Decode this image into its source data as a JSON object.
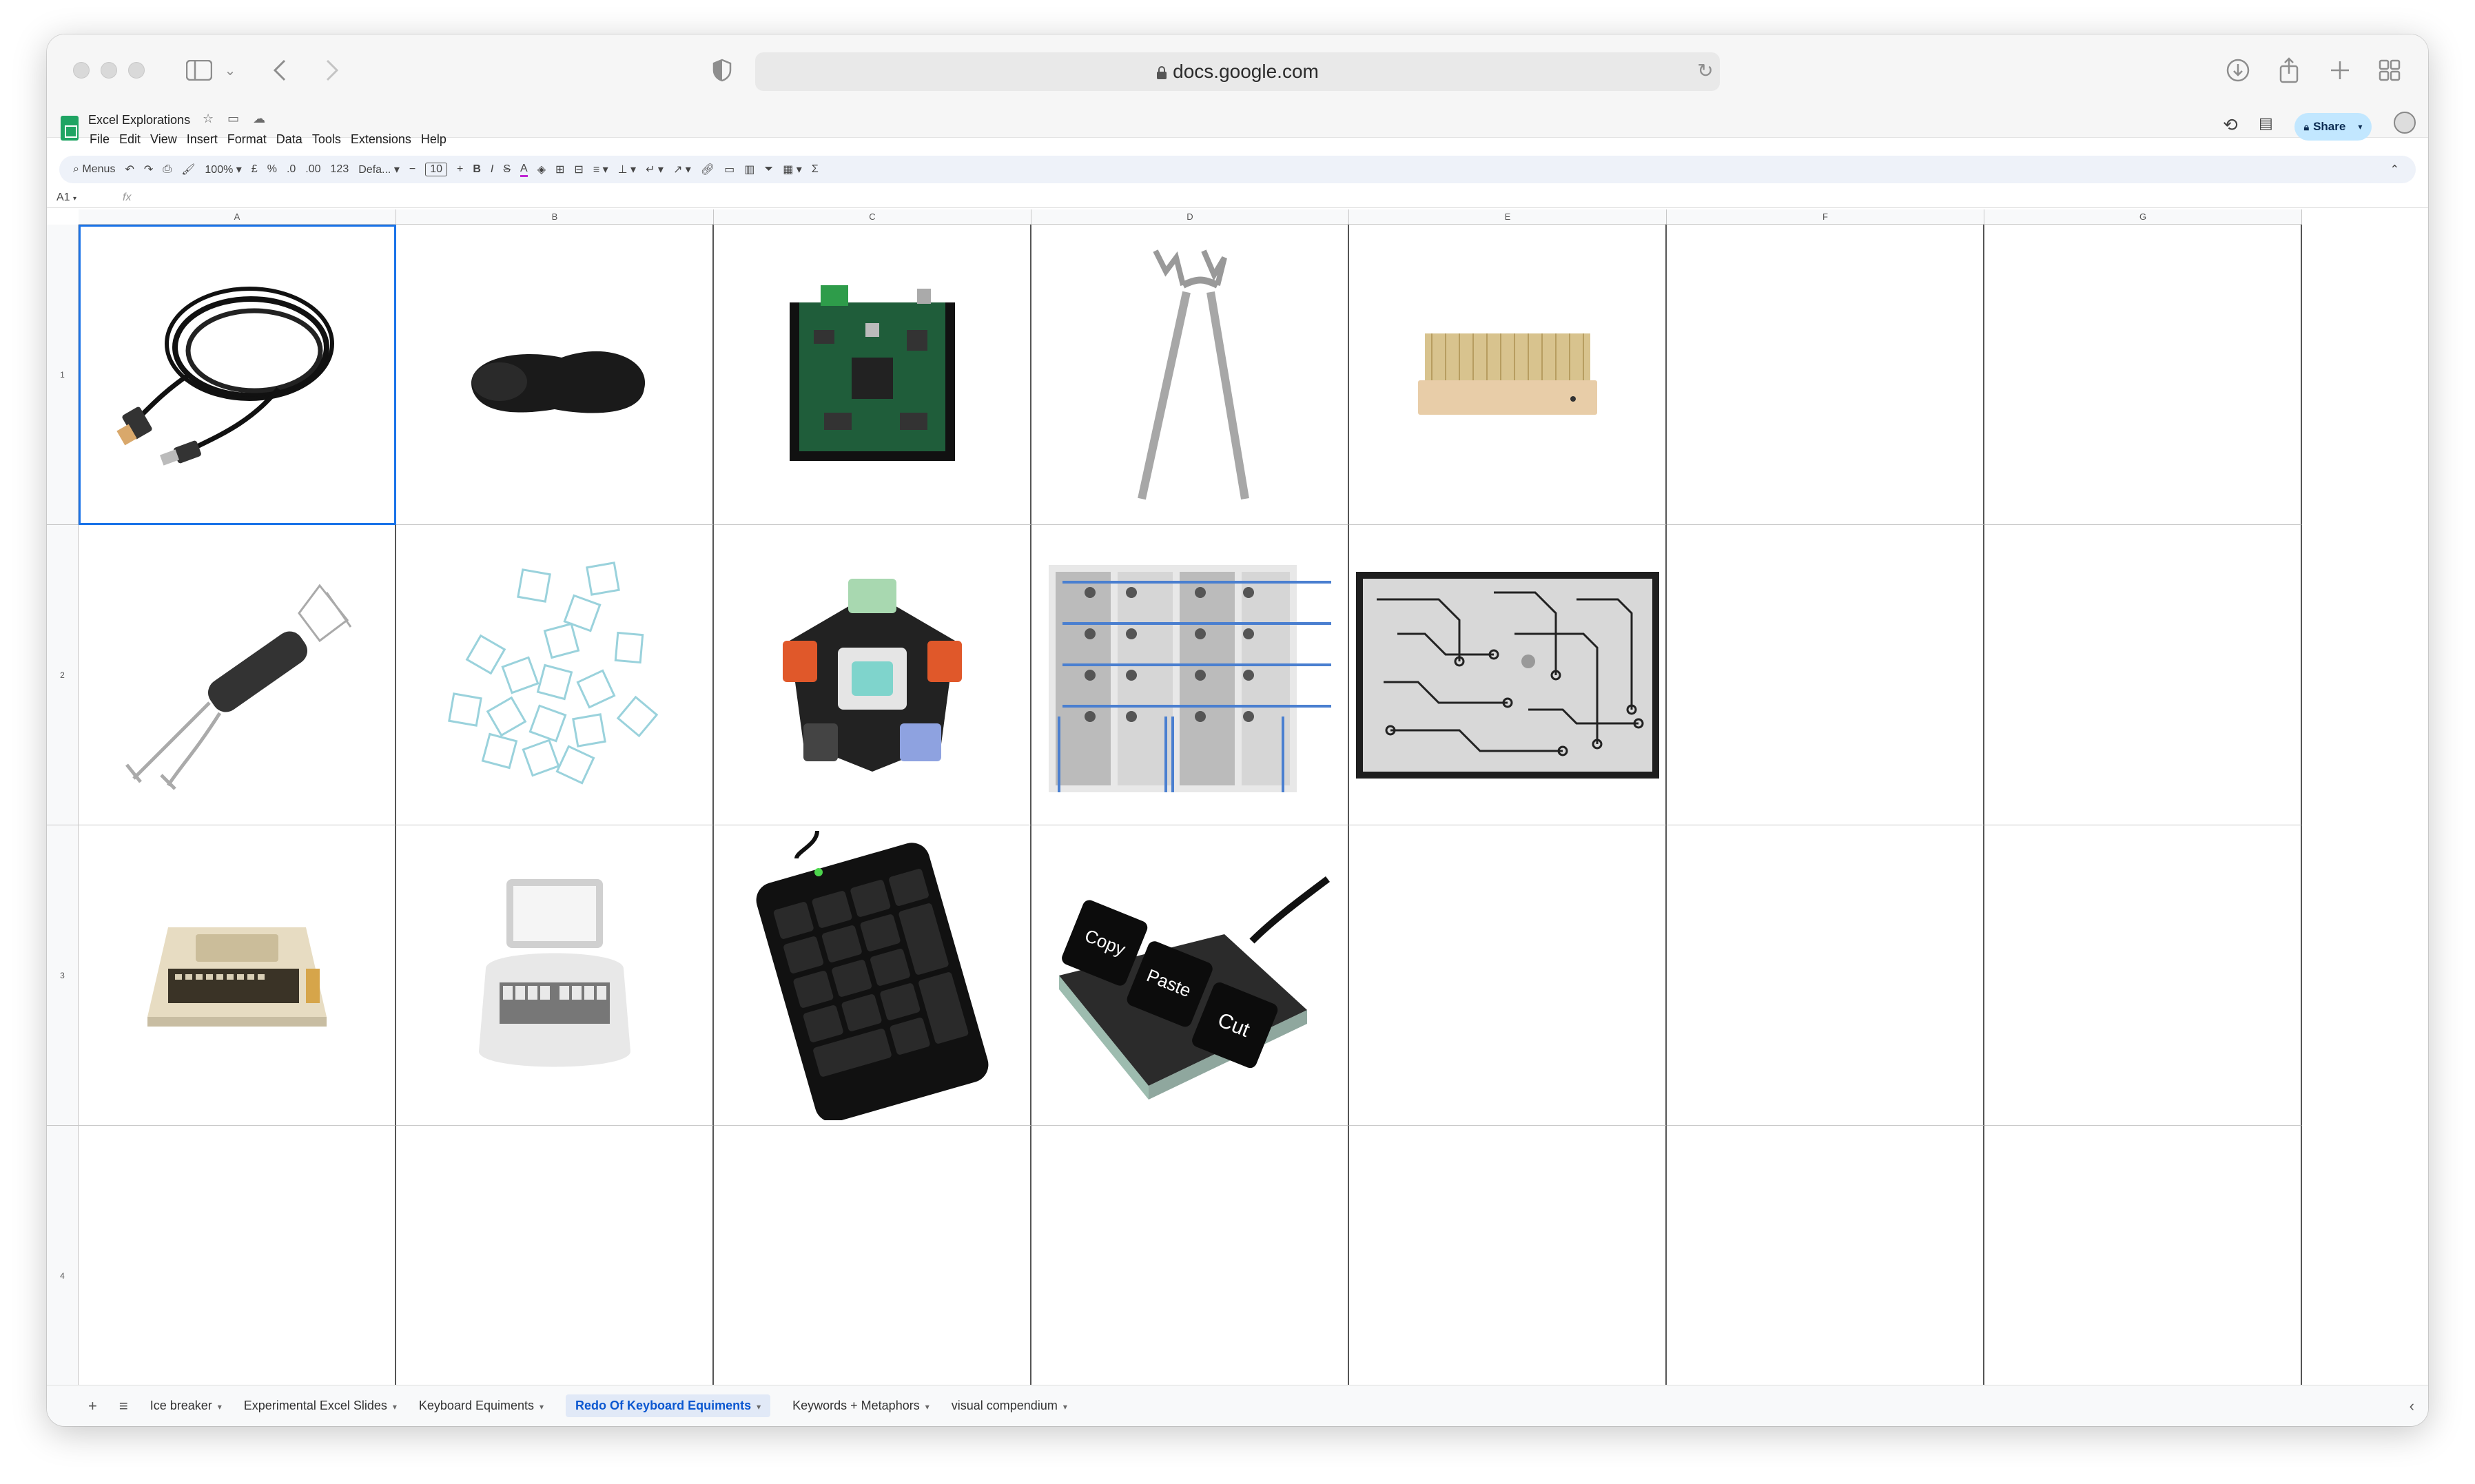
{
  "browser": {
    "url": "docs.google.com"
  },
  "doc": {
    "title": "Excel Explorations",
    "menus": [
      "File",
      "Edit",
      "View",
      "Insert",
      "Format",
      "Data",
      "Tools",
      "Extensions",
      "Help"
    ],
    "share_label": "Share"
  },
  "toolbar": {
    "menus_label": "Menus",
    "zoom": "100%",
    "currency": "£",
    "percent": "%",
    "dec_less": ".0",
    "dec_more": ".00",
    "number_format": "123",
    "font": "Defa...",
    "font_size": "10",
    "minus": "−",
    "plus": "+",
    "bold": "B",
    "italic": "I",
    "strike": "S",
    "text_color": "A",
    "sigma": "Σ"
  },
  "formula": {
    "cell_ref": "A1",
    "fx": "fx"
  },
  "columns": [
    "A",
    "B",
    "C",
    "D",
    "E",
    "F",
    "G"
  ],
  "rows": [
    "1",
    "2",
    "3",
    "4"
  ],
  "cell_images": {
    "A1": "usb-cable-image",
    "B1": "mouse-pad-image",
    "C1": "circuit-board-image",
    "D1": "keycap-puller-pliers-image",
    "E1": "cleaning-brush-image",
    "A2": "wire-keycap-puller-image",
    "B2": "keycap-outlines-image",
    "C2": "switch-tester-cube-image",
    "D2": "breadboard-matrix-image",
    "E2": "pcb-trace-image",
    "A3": "retro-computer-image",
    "B3": "stenotype-machine-image",
    "C3": "numpad-keyboard-image",
    "D3": "macro-keypad-image"
  },
  "macropad": {
    "key1": "Copy",
    "key2": "Paste",
    "key3": "Cut"
  },
  "tabs": [
    {
      "label": "Ice breaker"
    },
    {
      "label": "Experimental Excel Slides"
    },
    {
      "label": "Keyboard Equiments"
    },
    {
      "label": "Redo Of Keyboard Equiments"
    },
    {
      "label": "Keywords + Metaphors"
    },
    {
      "label": "visual compendium"
    }
  ]
}
